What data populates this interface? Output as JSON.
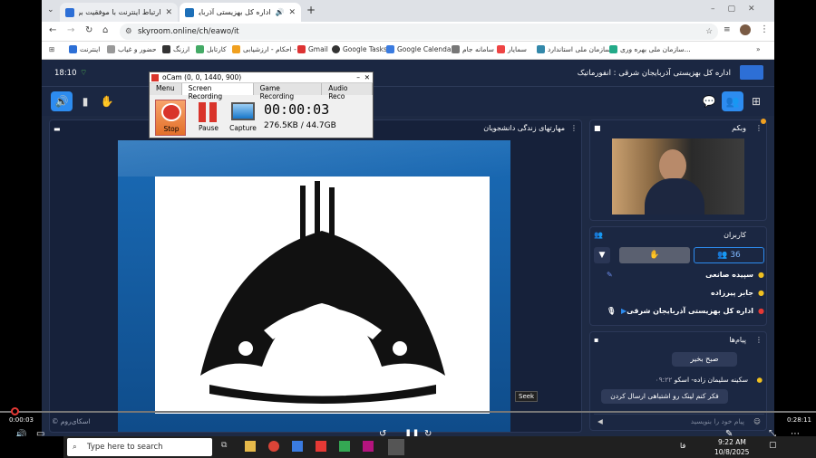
{
  "browser": {
    "tabs": [
      {
        "title": "ارتباط اینترنت با موفقیت برقرار شد"
      },
      {
        "title": "اداره کل بهزیستی آذربایجان ش"
      }
    ],
    "url": "skyroom.online/ch/eawo/it",
    "bookmarks": [
      "سازمان ملی بهره وری...",
      "سازمان ملی استاندارد",
      "سمایار",
      "سامانه جام",
      "Google Calendar",
      "Google Tasks",
      "Gmail",
      "احکام - ارزشیابی -",
      "کارتابل",
      "ارزنگ",
      "حضور و غیاب",
      "اینترنت"
    ]
  },
  "app": {
    "time": "18:10",
    "org_title": "اداره کل بهزیستی آذربایجان شرقی : انفورماتیک",
    "main_panel_title": "مهارتهای زندگی دانشجویان",
    "watermark": "© اسکای‌روم",
    "webcam_title": "وبکم",
    "users_title": "کاربران",
    "user_count": "36",
    "users": [
      {
        "name": "سپیده صانعی"
      },
      {
        "name": "جابر پیرزاده"
      },
      {
        "name": "اداره کل بهزیستی آذربایجان شرقی"
      }
    ],
    "messages_title": "پیام‌ها",
    "messages": [
      {
        "sender": "",
        "time": "",
        "text": "صبح بخیر"
      },
      {
        "sender": "سکینه سلیمان زاده- اسکو",
        "time": "۰۹:۲۲",
        "text": "فکر کنم لینک رو اشتباهی ارسال کردن"
      }
    ],
    "message_placeholder": "پیام خود را بنویسید"
  },
  "ocam": {
    "title": "oCam (0, 0, 1440, 900)",
    "tabs": [
      "Menu",
      "Screen Recording",
      "Game Recording",
      "Audio Reco"
    ],
    "stop_label": "Stop",
    "pause_label": "Pause",
    "capture_label": "Capture",
    "timer": "00:00:03",
    "size": "276.5KB / 44.7GB"
  },
  "player": {
    "current_time": "0:00:03",
    "total_time": "0:28:11",
    "seek_tooltip": "Seek",
    "progress": 0.0018
  },
  "taskbar": {
    "search_placeholder": "Type here to search",
    "clock_time": "9:22 AM",
    "clock_date": "10/8/2025",
    "lang": "فا"
  },
  "colors": {
    "accent": "#2d8cf0",
    "bg": "#1e2a44",
    "stop_red": "#d9342b"
  }
}
